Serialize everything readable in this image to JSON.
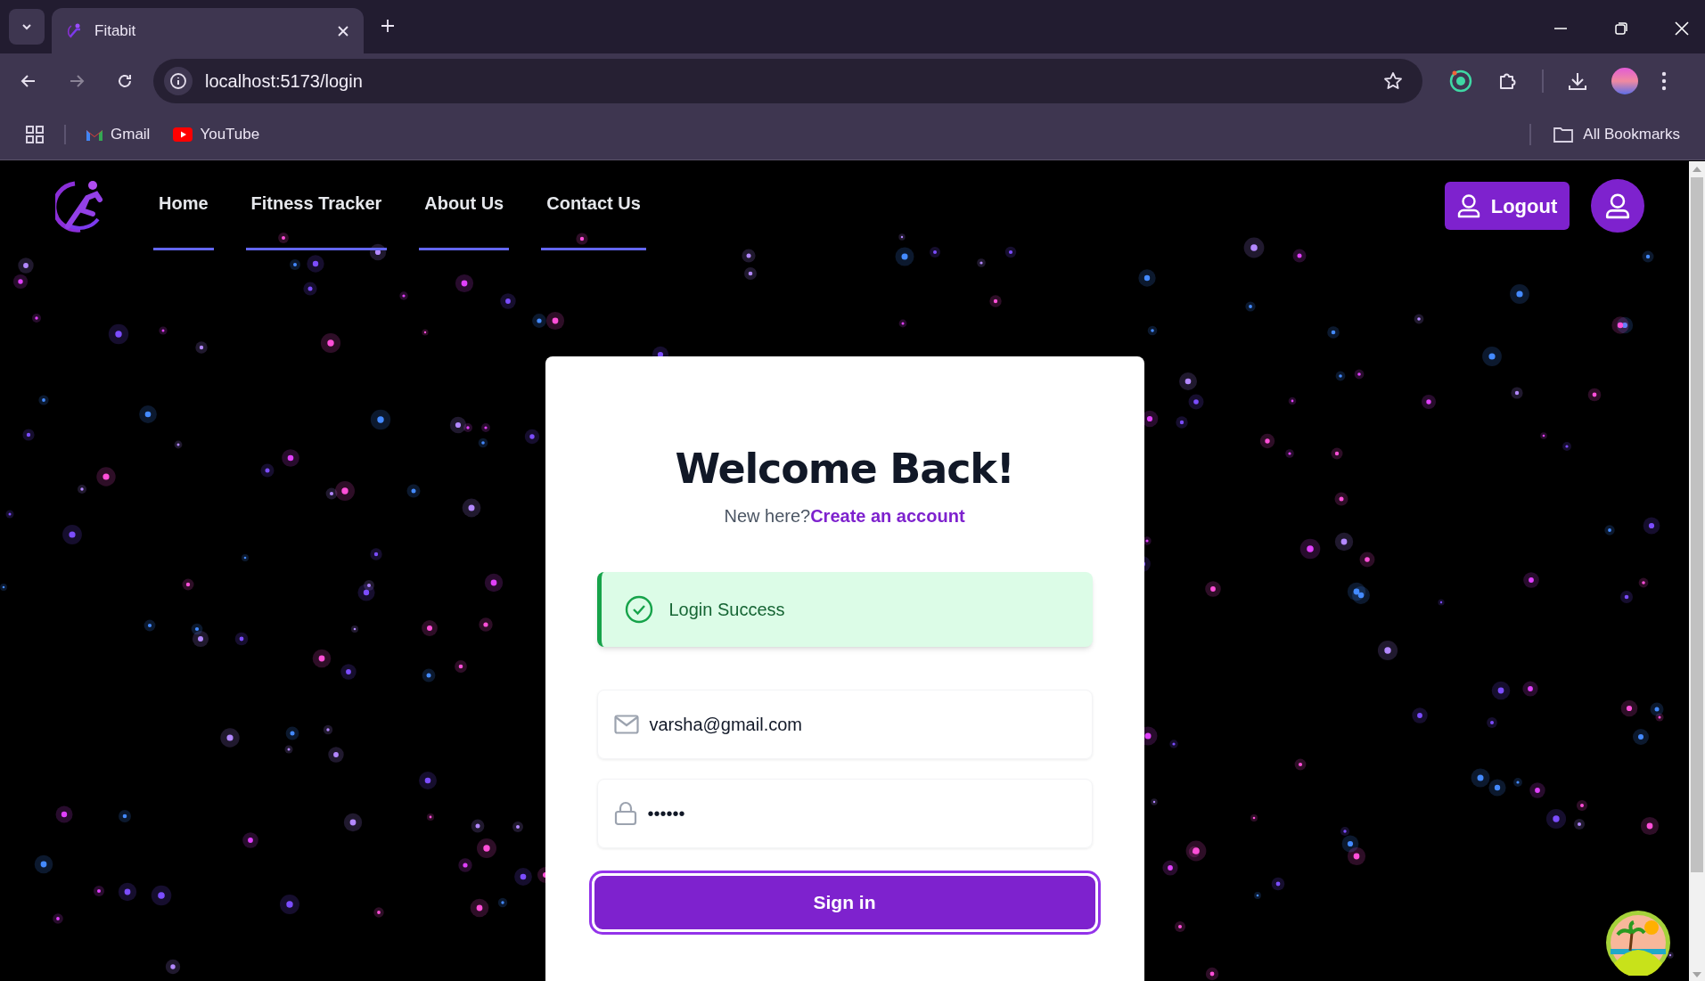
{
  "browser": {
    "tab_title": "Fitabit",
    "address": "localhost:5173/login",
    "bookmarks": [
      {
        "label": "Gmail",
        "kind": "gmail"
      },
      {
        "label": "YouTube",
        "kind": "youtube"
      }
    ],
    "all_bookmarks": "All Bookmarks"
  },
  "nav": {
    "links": [
      "Home",
      "Fitness Tracker",
      "About Us",
      "Contact Us"
    ],
    "logout": "Logout"
  },
  "card": {
    "title": "Welcome Back!",
    "prompt": "New here?",
    "signup_link": "Create an account",
    "alert": {
      "kind": "success",
      "text": "Login Success"
    },
    "fields": [
      {
        "kind": "email",
        "value": "varsha@gmail.com"
      },
      {
        "kind": "password",
        "value": "••••••"
      }
    ],
    "submit": "Sign in"
  }
}
